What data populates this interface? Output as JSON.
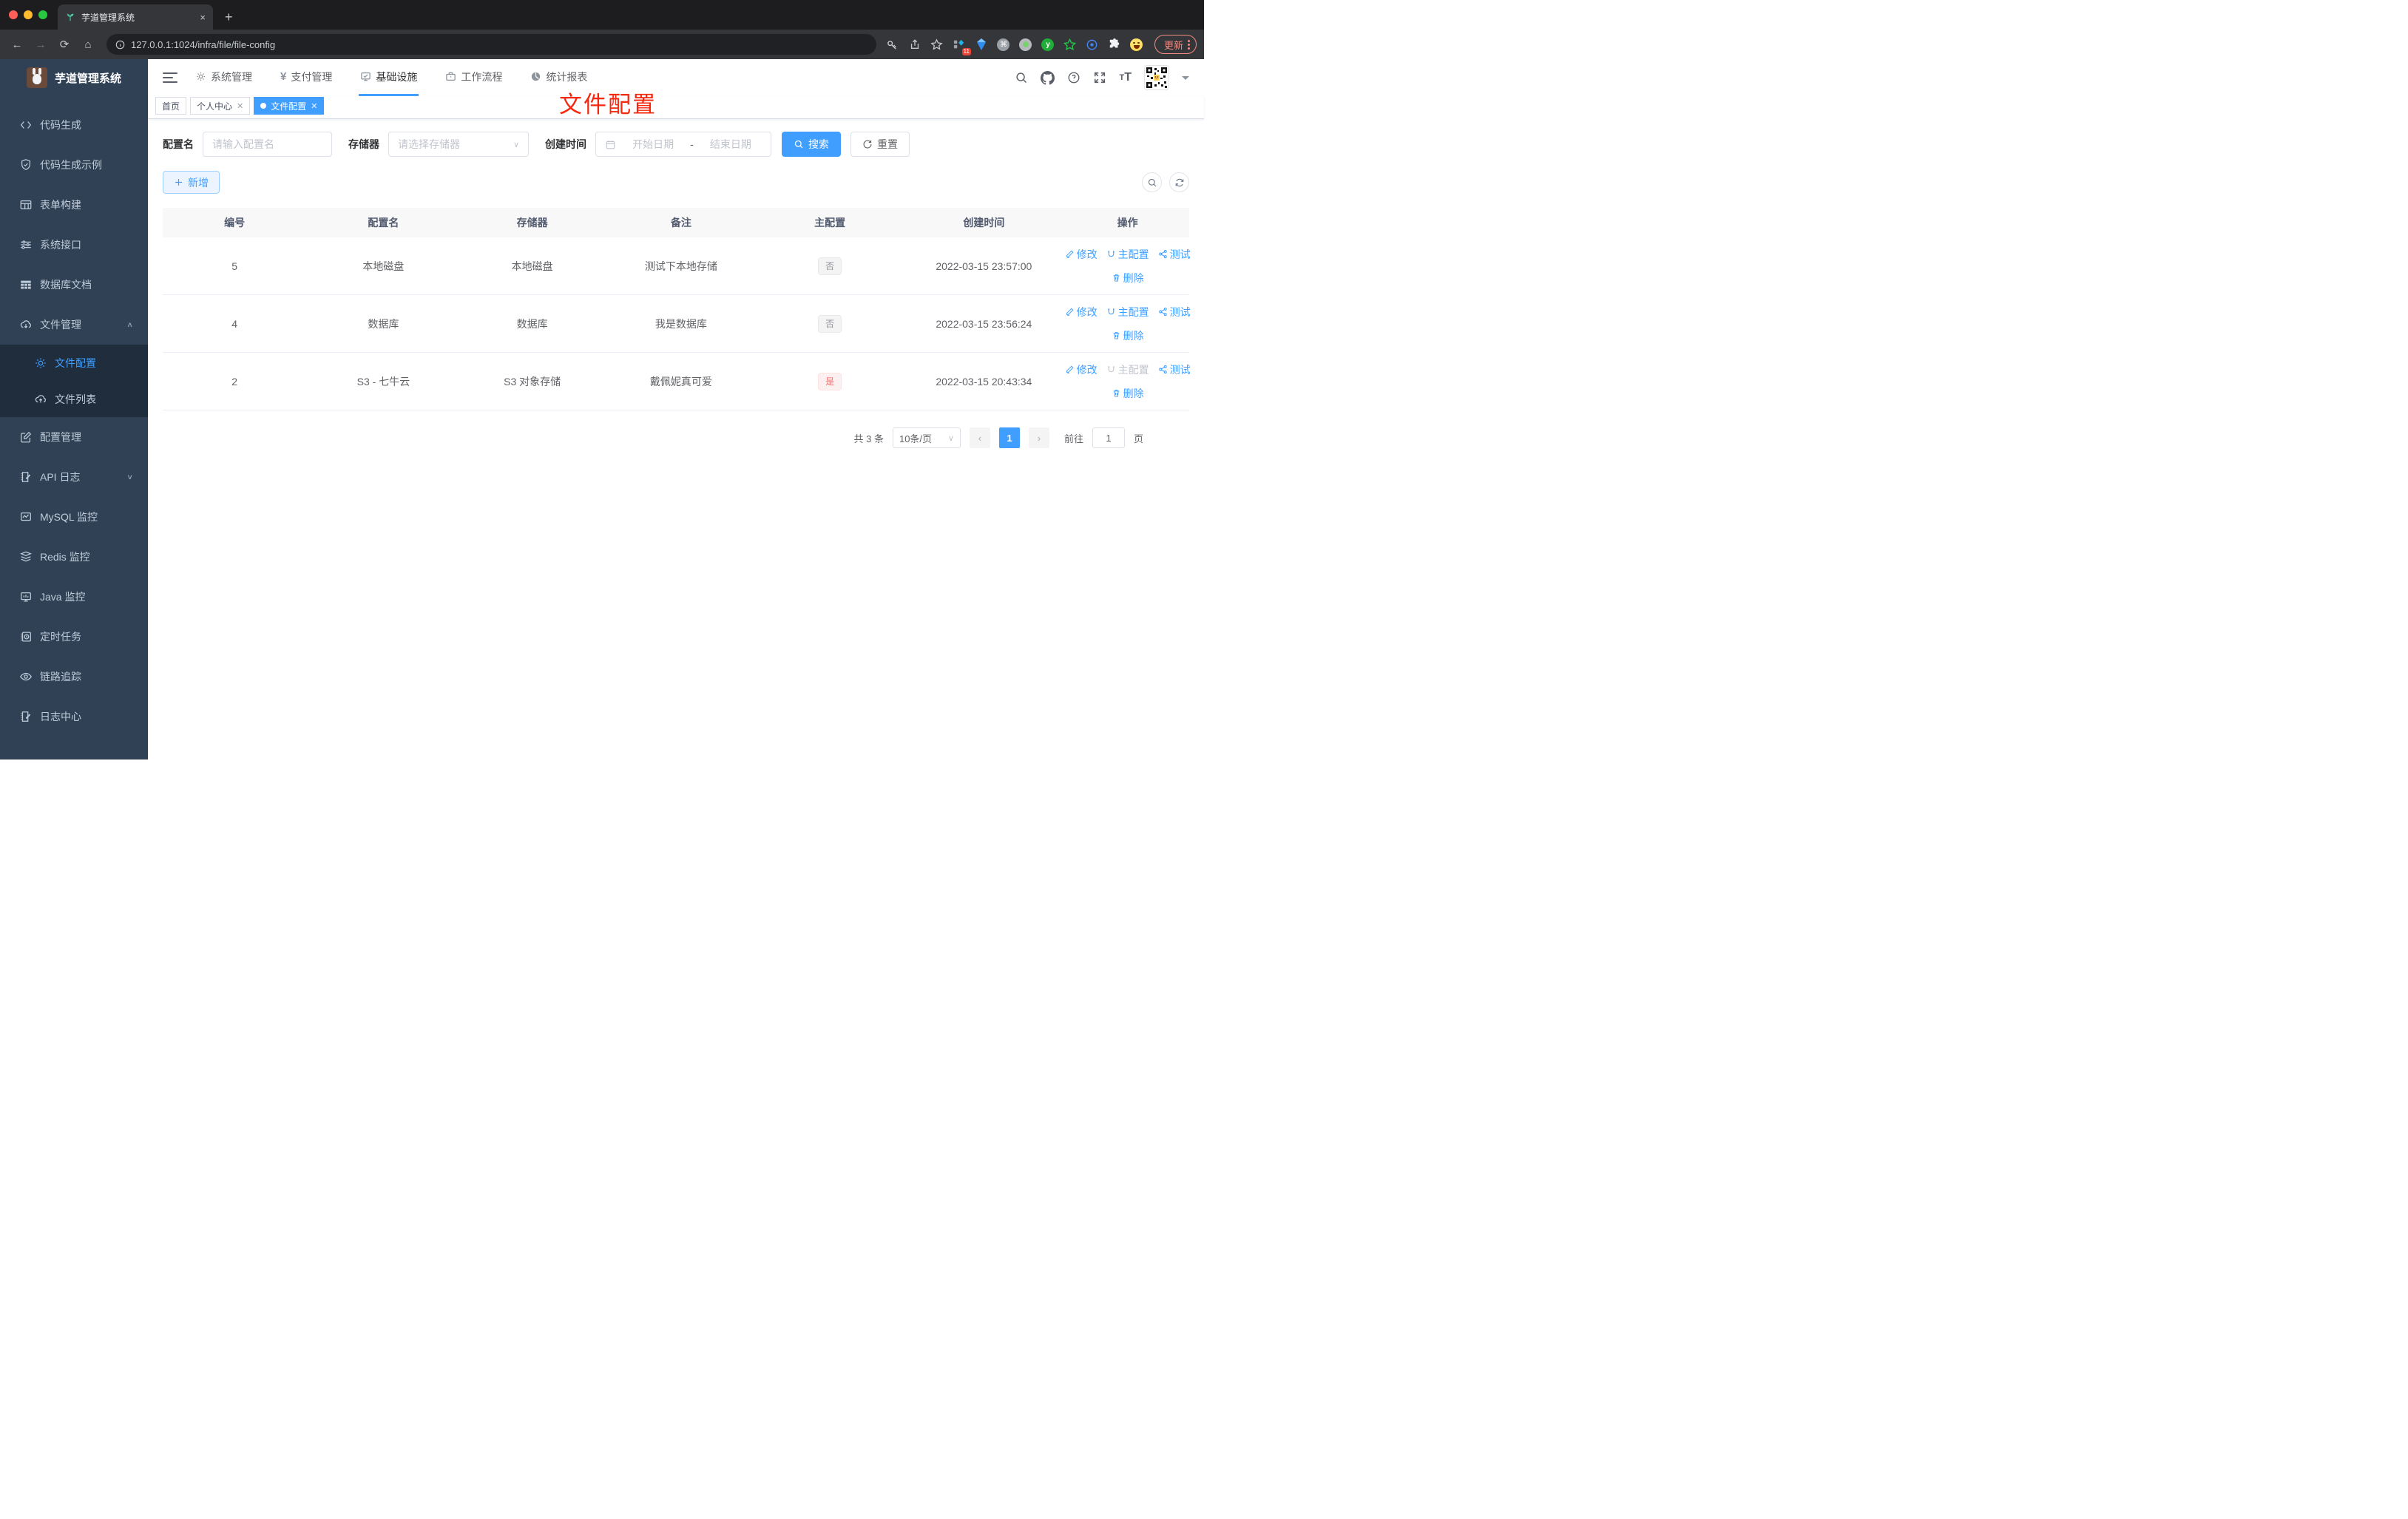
{
  "browser": {
    "tab_title": "芋道管理系统",
    "close_tab": "×",
    "new_tab": "+",
    "url": "127.0.0.1:1024/infra/file/file-config",
    "extension_badge": "11",
    "update_label": "更新"
  },
  "sidebar": {
    "app_title": "芋道管理系统",
    "items": [
      {
        "label": "代码生成"
      },
      {
        "label": "代码生成示例"
      },
      {
        "label": "表单构建"
      },
      {
        "label": "系统接口"
      },
      {
        "label": "数据库文档"
      },
      {
        "label": "文件管理"
      },
      {
        "label": "文件配置"
      },
      {
        "label": "文件列表"
      },
      {
        "label": "配置管理"
      },
      {
        "label": "API 日志"
      },
      {
        "label": "MySQL 监控"
      },
      {
        "label": "Redis 监控"
      },
      {
        "label": "Java 监控"
      },
      {
        "label": "定时任务"
      },
      {
        "label": "链路追踪"
      },
      {
        "label": "日志中心"
      }
    ]
  },
  "topnav": {
    "items": [
      {
        "label": "系统管理"
      },
      {
        "label": "支付管理"
      },
      {
        "label": "基础设施"
      },
      {
        "label": "工作流程"
      },
      {
        "label": "统计报表"
      }
    ]
  },
  "tabs": [
    {
      "label": "首页"
    },
    {
      "label": "个人中心"
    },
    {
      "label": "文件配置"
    }
  ],
  "page": {
    "red_title": "文件配置"
  },
  "filters": {
    "name_label": "配置名",
    "name_placeholder": "请输入配置名",
    "storage_label": "存储器",
    "storage_placeholder": "请选择存储器",
    "time_label": "创建时间",
    "start_placeholder": "开始日期",
    "range_separator": "-",
    "end_placeholder": "结束日期",
    "search_label": "搜索",
    "reset_label": "重置",
    "add_label": "新增"
  },
  "table": {
    "headers": [
      "编号",
      "配置名",
      "存储器",
      "备注",
      "主配置",
      "创建时间",
      "操作"
    ],
    "action_labels": {
      "edit": "修改",
      "master": "主配置",
      "test": "测试",
      "delete": "删除"
    },
    "rows": [
      {
        "id": "5",
        "name": "本地磁盘",
        "storage": "本地磁盘",
        "remark": "测试下本地存储",
        "master": "否",
        "created": "2022-03-15 23:57:00"
      },
      {
        "id": "4",
        "name": "数据库",
        "storage": "数据库",
        "remark": "我是数据库",
        "master": "否",
        "created": "2022-03-15 23:56:24"
      },
      {
        "id": "2",
        "name": "S3 - 七牛云",
        "storage": "S3 对象存储",
        "remark": "戴佩妮真可爱",
        "master": "是",
        "created": "2022-03-15 20:43:34"
      }
    ]
  },
  "pagination": {
    "total": "共 3 条",
    "page_size": "10条/页",
    "current_page": "1",
    "goto_label": "前往",
    "goto_value": "1",
    "page_unit": "页"
  },
  "colors": {
    "accent": "#409eff",
    "danger": "#f56c6c",
    "red_title": "#f5270d",
    "sidebar_bg": "#304156",
    "submenu_bg": "#1f2d3d"
  }
}
